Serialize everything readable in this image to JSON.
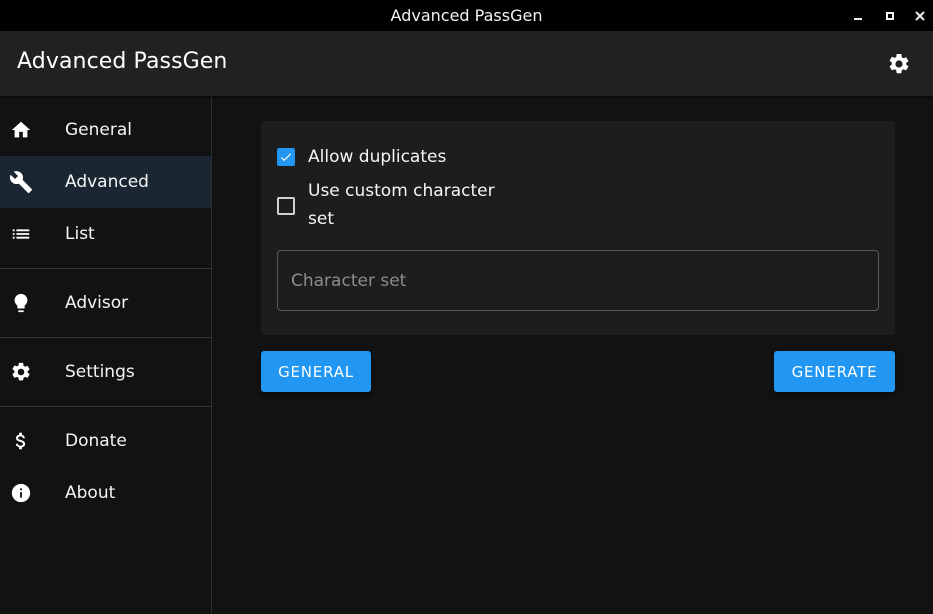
{
  "window": {
    "title": "Advanced PassGen"
  },
  "appbar": {
    "title": "Advanced PassGen",
    "settings_icon": "gear-icon"
  },
  "sidebar": {
    "items": [
      {
        "label": "General",
        "icon": "home-icon",
        "active": false
      },
      {
        "label": "Advanced",
        "icon": "wrench-icon",
        "active": true
      },
      {
        "label": "List",
        "icon": "list-icon",
        "active": false
      },
      {
        "label": "Advisor",
        "icon": "lightbulb-icon",
        "active": false
      },
      {
        "label": "Settings",
        "icon": "gear-icon",
        "active": false
      },
      {
        "label": "Donate",
        "icon": "dollar-icon",
        "active": false
      },
      {
        "label": "About",
        "icon": "info-icon",
        "active": false
      }
    ]
  },
  "main": {
    "allow_duplicates": {
      "label": "Allow duplicates",
      "checked": true
    },
    "custom_charset": {
      "label": "Use custom character set",
      "checked": false
    },
    "charset_field": {
      "placeholder": "Character set",
      "value": ""
    },
    "general_button": "GENERAL",
    "generate_button": "GENERATE"
  },
  "colors": {
    "accent": "#2196f3",
    "appbar": "#212121",
    "background": "#121212",
    "card": "#1d1d1d",
    "active_nav": "#1a2733"
  }
}
